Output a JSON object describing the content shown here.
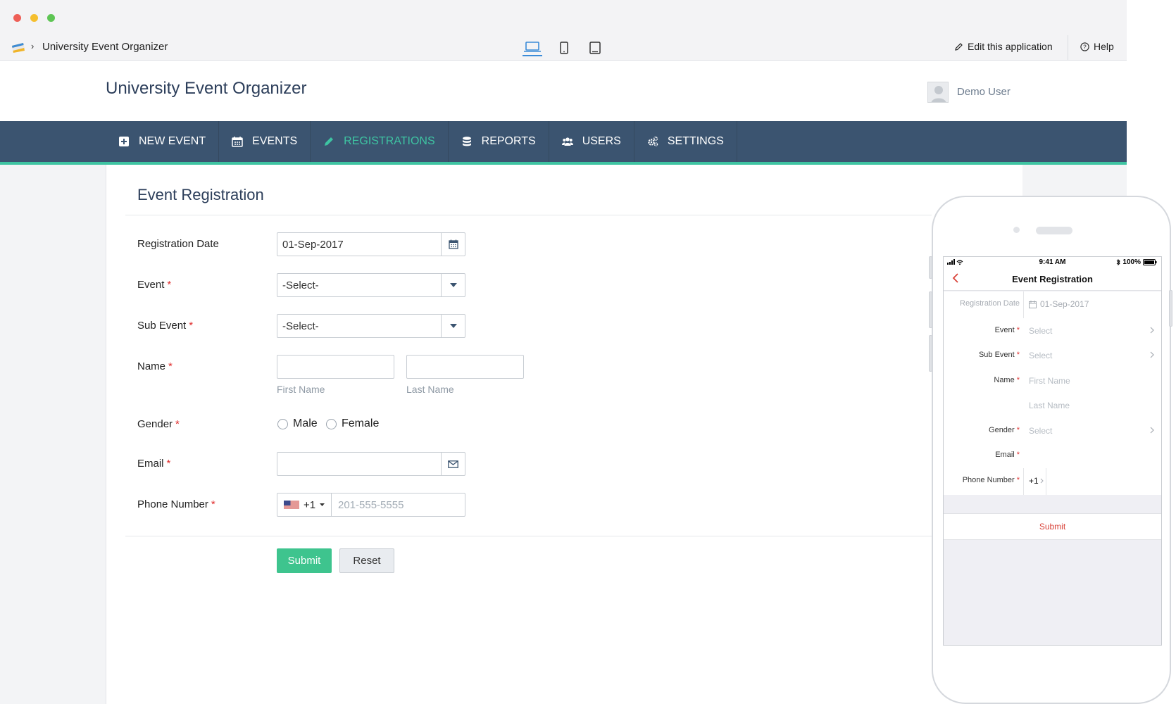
{
  "window": {
    "breadcrumb_separator": "›",
    "app_name": "University Event Organizer",
    "device_icons": [
      "laptop-icon",
      "mobile-icon",
      "tablet-icon"
    ],
    "edit_label": "Edit this application",
    "help_label": "Help"
  },
  "header": {
    "title": "University Event Organizer",
    "user_name": "Demo User"
  },
  "nav": {
    "items": [
      {
        "label": "NEW EVENT",
        "icon": "plus-square-icon"
      },
      {
        "label": "EVENTS",
        "icon": "calendar-icon"
      },
      {
        "label": "REGISTRATIONS",
        "icon": "pencil-icon",
        "active": true
      },
      {
        "label": "REPORTS",
        "icon": "database-icon"
      },
      {
        "label": "USERS",
        "icon": "users-icon"
      },
      {
        "label": "SETTINGS",
        "icon": "gears-icon"
      }
    ]
  },
  "form": {
    "title": "Event Registration",
    "registration_date": {
      "label": "Registration Date",
      "value": "01-Sep-2017"
    },
    "event": {
      "label": "Event",
      "value": "-Select-"
    },
    "sub_event": {
      "label": "Sub Event",
      "value": "-Select-"
    },
    "name": {
      "label": "Name",
      "first_hint": "First Name",
      "last_hint": "Last Name"
    },
    "gender": {
      "label": "Gender",
      "options": [
        "Male",
        "Female"
      ]
    },
    "email": {
      "label": "Email",
      "value": ""
    },
    "phone": {
      "label": "Phone Number",
      "country_code": "+1",
      "placeholder": "201-555-5555"
    },
    "required_mark": "*",
    "submit_label": "Submit",
    "reset_label": "Reset"
  },
  "mobile": {
    "status_time": "9:41 AM",
    "battery": "100%",
    "title": "Event Registration",
    "registration_date": {
      "label": "Registration Date",
      "value": "01-Sep-2017"
    },
    "event": {
      "label": "Event",
      "value": "Select"
    },
    "sub_event": {
      "label": "Sub Event",
      "value": "Select"
    },
    "name": {
      "label": "Name",
      "first": "First Name",
      "last": "Last Name"
    },
    "gender": {
      "label": "Gender",
      "value": "Select"
    },
    "email": {
      "label": "Email"
    },
    "phone": {
      "label": "Phone Number",
      "code": "+1"
    },
    "required_mark": "*",
    "submit_label": "Submit"
  },
  "colors": {
    "nav_bg": "#3b5470",
    "accent": "#3ec4a2",
    "submit_bg": "#3ec48e",
    "required": "#e03131",
    "mobile_submit": "#d9433a"
  }
}
